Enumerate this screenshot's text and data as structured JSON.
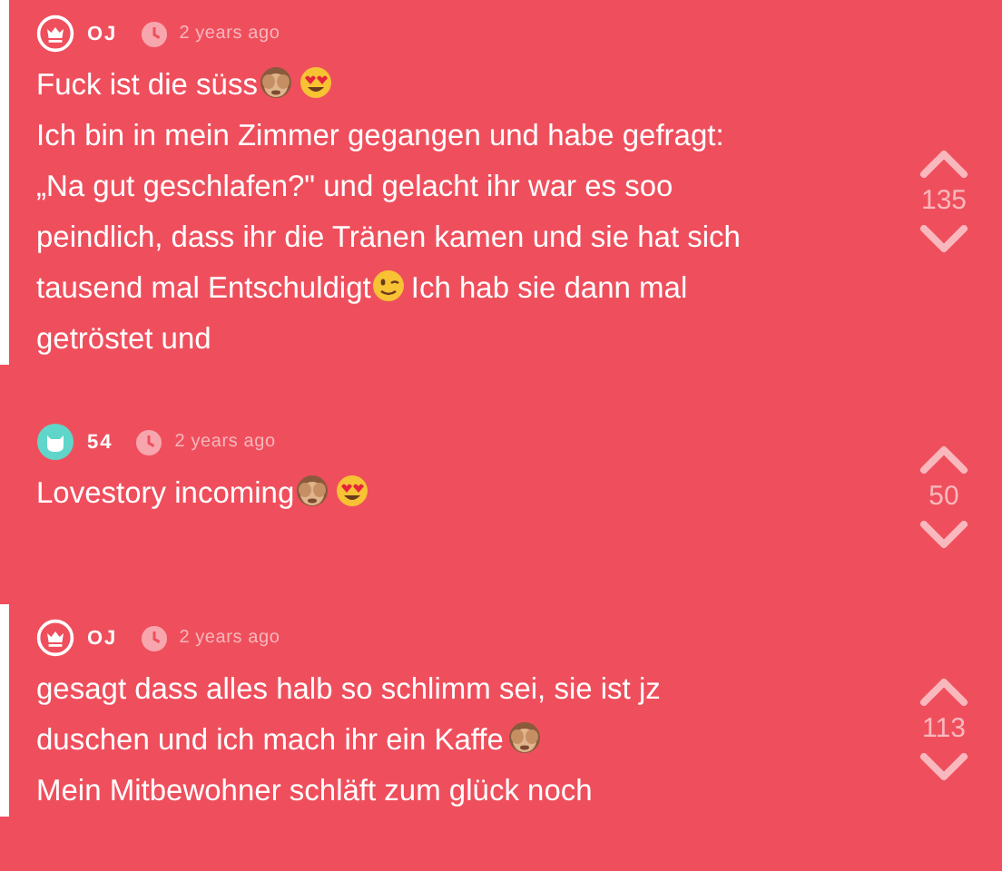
{
  "posts": [
    {
      "author": {
        "kind": "op",
        "label": "OJ"
      },
      "time": "2 years ago",
      "lines": [
        [
          {
            "kind": "text",
            "text": "Fuck ist die süss"
          },
          {
            "kind": "monkey"
          },
          {
            "kind": "hearteyes"
          }
        ],
        [
          {
            "kind": "text",
            "text": "Ich bin in mein Zimmer gegangen und habe gefragt:"
          }
        ],
        [
          {
            "kind": "text",
            "text": "„Na gut geschlafen?\" und gelacht ihr war es soo"
          }
        ],
        [
          {
            "kind": "text",
            "text": "peindlich, dass ihr die Tränen kamen und sie hat sich"
          }
        ],
        [
          {
            "kind": "text",
            "text": "tausend mal Entschuldigt"
          },
          {
            "kind": "wink"
          },
          {
            "kind": "text",
            "text": "Ich hab sie dann mal"
          }
        ],
        [
          {
            "kind": "text",
            "text": "getröstet und"
          }
        ]
      ],
      "score": "135"
    },
    {
      "author": {
        "kind": "user",
        "label": "54",
        "color": "#5fd6c9"
      },
      "time": "2 years ago",
      "lines": [
        [
          {
            "kind": "text",
            "text": "Lovestory incoming"
          },
          {
            "kind": "monkey"
          },
          {
            "kind": "hearteyes"
          }
        ]
      ],
      "score": "50"
    },
    {
      "author": {
        "kind": "op",
        "label": "OJ"
      },
      "time": "2 years ago",
      "lines": [
        [
          {
            "kind": "text",
            "text": "gesagt dass alles halb so schlimm sei, sie ist jz"
          }
        ],
        [
          {
            "kind": "text",
            "text": "duschen und ich mach ihr ein Kaffe"
          },
          {
            "kind": "monkey"
          }
        ],
        [
          {
            "kind": "text",
            "text": "Mein Mitbewohner schläft zum glück noch"
          }
        ]
      ],
      "score": "113"
    }
  ]
}
